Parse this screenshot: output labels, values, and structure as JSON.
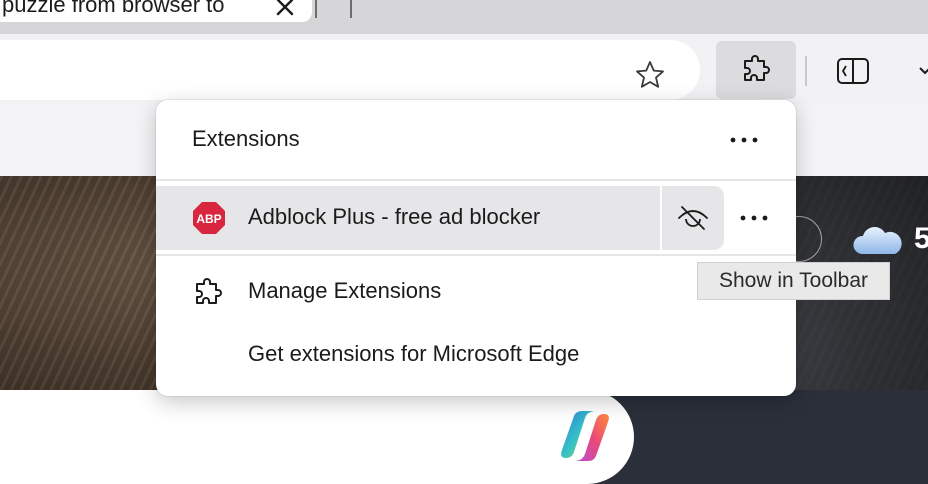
{
  "tab": {
    "title": "puzzle from browser to",
    "close_icon": "close-icon"
  },
  "toolbar": {
    "favorite_icon": "star-icon",
    "extensions_icon": "puzzle-icon",
    "split_screen_icon": "split-screen-icon"
  },
  "page": {
    "weather_temp": "5"
  },
  "extensions_popup": {
    "title": "Extensions",
    "items": [
      {
        "name": "Adblock Plus - free ad blocker",
        "logo_text": "ABP",
        "visibility_icon": "eye-slash-icon"
      }
    ],
    "manage_label": "Manage Extensions",
    "get_extensions_label": "Get extensions for Microsoft Edge"
  },
  "tooltip": {
    "text": "Show in Toolbar"
  },
  "colors": {
    "abp_red": "#d7263d",
    "popup_bg": "#ffffff",
    "hover_bg": "#e6e6e9"
  }
}
